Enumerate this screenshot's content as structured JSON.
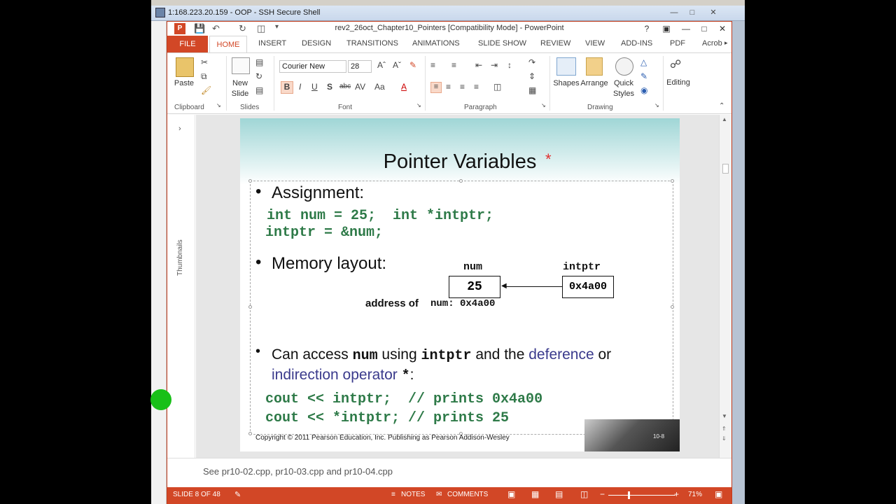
{
  "ssh": {
    "title": "1:168.223.20.159 - OOP - SSH Secure Shell"
  },
  "ppt": {
    "title": "rev2_26oct_Chapter10_Pointers [Compatibility Mode] - PowerPoint",
    "help": "?",
    "tabs": [
      "FILE",
      "HOME",
      "INSERT",
      "DESIGN",
      "TRANSITIONS",
      "ANIMATIONS",
      "SLIDE SHOW",
      "REVIEW",
      "VIEW",
      "ADD-INS",
      "PDF",
      "Acrob"
    ],
    "ribbon": {
      "paste": "Paste",
      "new_slide_1": "New",
      "new_slide_2": "Slide",
      "font_name": "Courier New",
      "font_size": "28",
      "shapes": "Shapes",
      "arrange": "Arrange",
      "quick_styles_1": "Quick",
      "quick_styles_2": "Styles",
      "editing": "Editing",
      "groups": [
        "Clipboard",
        "Slides",
        "Font",
        "Paragraph",
        "Drawing"
      ]
    },
    "thumbnails_label": "Thumbnails",
    "slide": {
      "title": "Pointer Variables",
      "title_star": "*",
      "b1": "Assignment:",
      "code1": "int num = 25;  int *intptr;",
      "code2": "intptr = &num;",
      "b2": "Memory layout:",
      "mem_num_label": "num",
      "mem_num_value": "25",
      "mem_ptr_label": "intptr",
      "mem_ptr_value": "0x4a00",
      "address_prefix": "address of",
      "address_value": "num: 0x4a00",
      "b3_a": "Can access",
      "b3_num": "num",
      "b3_b": "using",
      "b3_intptr": "intptr",
      "b3_c": "and the",
      "b3_deref": "deference",
      "b3_d": "or",
      "b3_indir": "indirection operator",
      "b3_star": "*",
      "b3_colon": ":",
      "code3": "cout << intptr;  // prints 0x4a00",
      "code4": "cout << *intptr; // prints 25",
      "footer": "Copyright © 2011 Pearson Education, Inc. Publishing as Pearson Addison-Wesley",
      "photo_caption": "10-8"
    },
    "notes": "See pr10-02.cpp, pr10-03.cpp and pr10-04.cpp",
    "status": {
      "slide": "SLIDE 8 OF 48",
      "notes": "NOTES",
      "comments": "COMMENTS",
      "zoom": "71%"
    }
  },
  "colors": {
    "accent": "#d24726",
    "code_green": "#2e7a48",
    "operator_blue": "#3a3a8c"
  }
}
